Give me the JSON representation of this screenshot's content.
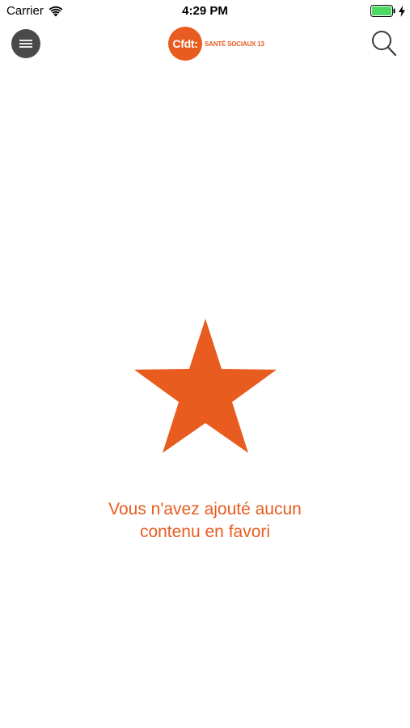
{
  "status_bar": {
    "carrier": "Carrier",
    "time": "4:29 PM"
  },
  "header": {
    "logo_mark": "Cfdt:",
    "logo_subtitle": "SANTÉ SOCIAUX 13",
    "menu_icon": "hamburger-menu-icon",
    "search_icon": "search-icon"
  },
  "empty_state": {
    "icon": "star-icon",
    "message_line1": "Vous n'avez ajouté aucun",
    "message_line2": "contenu en favori"
  },
  "colors": {
    "accent": "#e85c20",
    "menu_button_bg": "#4a4a4a",
    "battery_fill": "#4cd964"
  }
}
